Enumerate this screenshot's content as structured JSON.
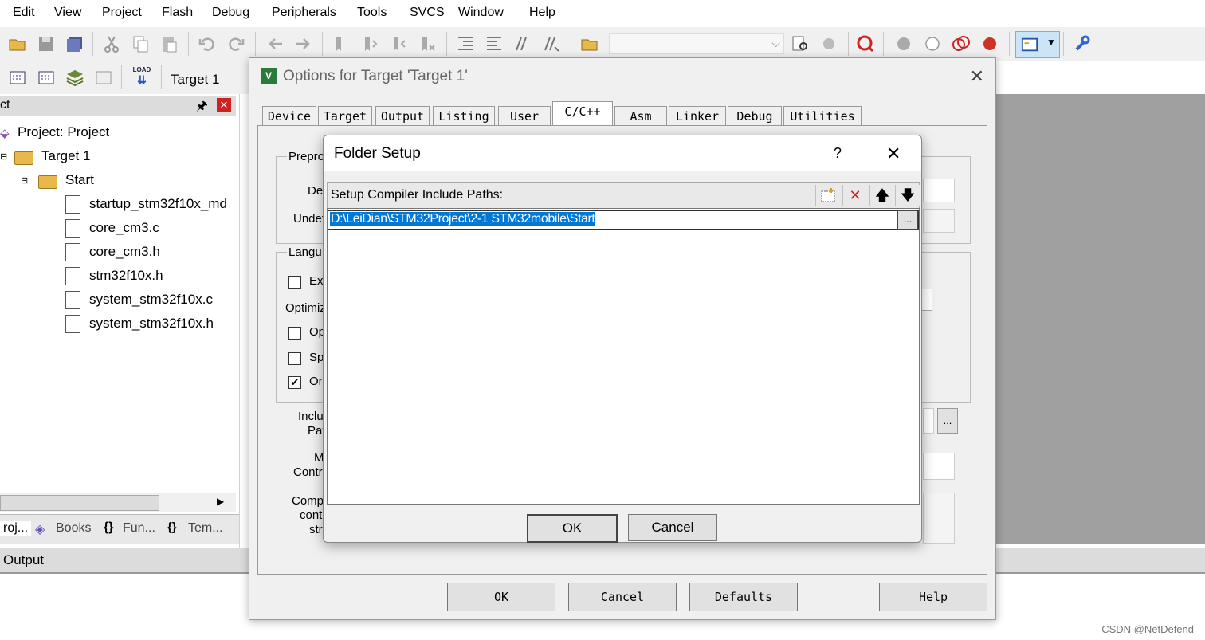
{
  "menu": [
    "Edit",
    "View",
    "Project",
    "Flash",
    "Debug",
    "Peripherals",
    "Tools",
    "SVCS",
    "Window",
    "Help"
  ],
  "toolbar2": {
    "target_select": "Target 1"
  },
  "project_pane": {
    "title": "ct",
    "tree": {
      "root": "Project: Project",
      "target": "Target 1",
      "group": "Start",
      "files": [
        "startup_stm32f10x_md",
        "core_cm3.c",
        "core_cm3.h",
        "stm32f10x.h",
        "system_stm32f10x.c",
        "system_stm32f10x.h"
      ]
    },
    "tabs": [
      "roj...",
      "Books",
      "Fun...",
      "Tem..."
    ]
  },
  "output": {
    "label": "Output"
  },
  "options_dialog": {
    "title": "Options for Target 'Target 1'",
    "tabs": [
      "Device",
      "Target",
      "Output",
      "Listing",
      "User",
      "C/C++",
      "Asm",
      "Linker",
      "Debug",
      "Utilities"
    ],
    "active_tab": "C/C++",
    "groups": {
      "preprocessor": "Prepro",
      "language": "Langu"
    },
    "fields": {
      "define": "Def",
      "undefine": "Undef"
    },
    "options": {
      "execute_only": "Ex",
      "optimization": "Optimiz",
      "opt_time": "Op",
      "split_load": "Sp",
      "one_elf": "Or"
    },
    "checks": {
      "execute_only": false,
      "opt_time": false,
      "split_load": false,
      "one_elf": true
    },
    "misc": {
      "include_paths_1": "Inclu",
      "include_paths_2": "Pat",
      "misc_controls_1": "M",
      "misc_controls_2": "Contr",
      "compiler_1": "Comp",
      "compiler_2": "cont",
      "compiler_3": "stri",
      "browse": "..."
    },
    "buttons": {
      "ok": "OK",
      "cancel": "Cancel",
      "defaults": "Defaults",
      "help": "Help"
    }
  },
  "folder_setup": {
    "title": "Folder Setup",
    "help_glyph": "?",
    "close_glyph": "✕",
    "list_header": "Setup Compiler Include Paths:",
    "paths": [
      "D:\\LeiDian\\STM32Project\\2-1 STM32mobile\\Start"
    ],
    "browse": "...",
    "buttons": {
      "ok": "OK",
      "cancel": "Cancel"
    }
  },
  "watermark": "CSDN @NetDefend",
  "colors": {
    "selection": "#0078d7",
    "folder": "#e8b84a",
    "accent_red": "#cc2222"
  }
}
